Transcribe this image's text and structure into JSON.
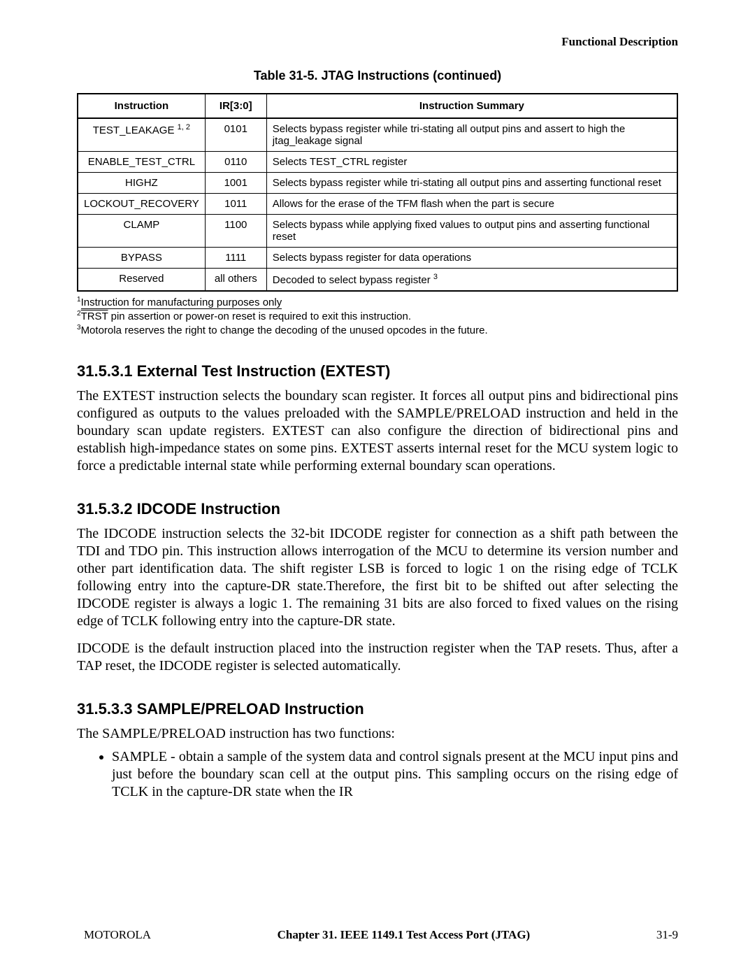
{
  "runningHead": "Functional Description",
  "tableCaption": "Table 31-5. JTAG Instructions (continued)",
  "table": {
    "headers": [
      "Instruction",
      "IR[3:0]",
      "Instruction Summary"
    ],
    "rows": [
      {
        "instr": "TEST_LEAKAGE",
        "instr_sup": "1, 2",
        "ir": "0101",
        "summary": "Selects bypass register while tri-stating all output pins and assert to high the jtag_leakage signal"
      },
      {
        "instr": "ENABLE_TEST_CTRL",
        "instr_sup": "",
        "ir": "0110",
        "summary": "Selects TEST_CTRL register"
      },
      {
        "instr": "HIGHZ",
        "instr_sup": "",
        "ir": "1001",
        "summary": "Selects bypass register while tri-stating all output pins and asserting functional reset"
      },
      {
        "instr": "LOCKOUT_RECOVERY",
        "instr_sup": "",
        "ir": "1011",
        "summary": "Allows for the erase of the TFM flash when the part is secure"
      },
      {
        "instr": "CLAMP",
        "instr_sup": "",
        "ir": "1100",
        "summary": "Selects bypass while applying fixed values to output pins and asserting functional reset"
      },
      {
        "instr": "BYPASS",
        "instr_sup": "",
        "ir": "1111",
        "summary": "Selects bypass register for data operations"
      },
      {
        "instr": "Reserved",
        "instr_sup": "",
        "ir": "all others",
        "summary": "Decoded to select bypass register",
        "summary_sup": "3"
      }
    ]
  },
  "footnotes": {
    "n1": "Instruction for manufacturing purposes only",
    "n2_a": "TRST",
    "n2_b": " pin assertion or power-on reset is required to exit this instruction.",
    "n3": "Motorola reserves the right to change the decoding of the unused opcodes in the future."
  },
  "sections": {
    "s1": {
      "heading": "31.5.3.1  External Test Instruction (EXTEST)",
      "p1": "The EXTEST instruction selects the boundary scan register. It forces all output pins and bidirectional pins configured as outputs to the values preloaded with the SAMPLE/PRELOAD instruction and held in the boundary scan update registers. EXTEST can also configure the direction of bidirectional pins and establish high-impedance states on some pins. EXTEST asserts internal reset for the MCU system logic to force a predictable internal state while performing external boundary scan operations."
    },
    "s2": {
      "heading": "31.5.3.2  IDCODE Instruction",
      "p1": "The IDCODE instruction selects the 32-bit IDCODE register for connection as a shift path between the TDI and TDO pin. This instruction allows interrogation of the MCU to determine its version number and other part identification data. The shift register LSB is forced to logic 1 on the rising edge of TCLK following entry into the capture-DR state.Therefore, the first bit to be shifted out after selecting the IDCODE register is always a logic 1. The remaining 31 bits are also forced to fixed values on the rising edge of TCLK following entry into the capture-DR state.",
      "p2": "IDCODE is the default instruction placed into the instruction register when the TAP resets. Thus, after a TAP reset, the IDCODE register is selected automatically."
    },
    "s3": {
      "heading": "31.5.3.3  SAMPLE/PRELOAD Instruction",
      "p1": "The SAMPLE/PRELOAD instruction has two functions:",
      "b1": "SAMPLE - obtain a sample of the system data and control signals present at the MCU input pins and just before the boundary scan cell at the output pins. This sampling occurs on the rising edge of TCLK in the capture-DR state when the IR"
    }
  },
  "footer": {
    "left": "MOTOROLA",
    "mid": "Chapter 31.  IEEE 1149.1 Test Access Port (JTAG)",
    "right": "31-9"
  }
}
